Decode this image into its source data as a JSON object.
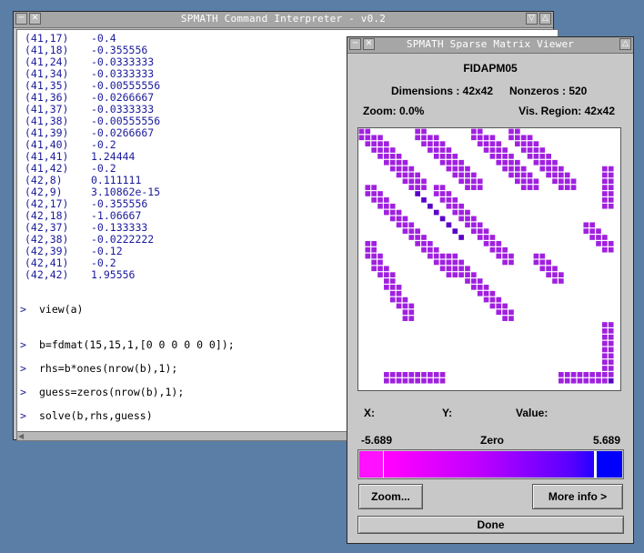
{
  "cmd_window": {
    "title": "SPMATH Command Interpreter - v0.2",
    "output_rows": [
      {
        "idx": "(41,17)",
        "val": "-0.4"
      },
      {
        "idx": "(41,18)",
        "val": "-0.355556"
      },
      {
        "idx": "(41,24)",
        "val": "-0.0333333"
      },
      {
        "idx": "(41,34)",
        "val": "-0.0333333"
      },
      {
        "idx": "(41,35)",
        "val": "-0.00555556"
      },
      {
        "idx": "(41,36)",
        "val": "-0.0266667"
      },
      {
        "idx": "(41,37)",
        "val": "-0.0333333"
      },
      {
        "idx": "(41,38)",
        "val": "-0.00555556"
      },
      {
        "idx": "(41,39)",
        "val": "-0.0266667"
      },
      {
        "idx": "(41,40)",
        "val": "-0.2"
      },
      {
        "idx": "(41,41)",
        "val": "1.24444"
      },
      {
        "idx": "(41,42)",
        "val": "-0.2"
      },
      {
        "idx": "(42,8)",
        "val": "0.111111"
      },
      {
        "idx": "(42,9)",
        "val": "3.10862e-15"
      },
      {
        "idx": "(42,17)",
        "val": "-0.355556"
      },
      {
        "idx": "(42,18)",
        "val": "-1.06667"
      },
      {
        "idx": "(42,37)",
        "val": "-0.133333"
      },
      {
        "idx": "(42,38)",
        "val": "-0.0222222"
      },
      {
        "idx": "(42,39)",
        "val": "-0.12"
      },
      {
        "idx": "(42,41)",
        "val": "-0.2"
      },
      {
        "idx": "(42,42)",
        "val": "1.95556"
      }
    ],
    "prompt_symbol": ">",
    "commands": [
      "view(a)",
      "b=fdmat(15,15,1,[0 0 0 0 0 0]);",
      "rhs=b*ones(nrow(b),1);",
      "guess=zeros(nrow(b),1);",
      "solve(b,rhs,guess)"
    ]
  },
  "viewer": {
    "title": "SPMATH Sparse Matrix Viewer",
    "matrix_name": "FIDAPM05",
    "dimensions_label": "Dimensions : 42x42",
    "nonzeros_label": "Nonzeros : 520",
    "zoom_label": "Zoom: 0.0%",
    "vis_region_label": "Vis. Region: 42x42",
    "x_label": "X:",
    "y_label": "Y:",
    "value_label": "Value:",
    "scale_min": "-5.689",
    "scale_mid": "Zero",
    "scale_max": "5.689",
    "zoom_button": "Zoom...",
    "more_info_button": "More info >",
    "done_button": "Done",
    "colors": {
      "negative": "#ff00ff",
      "positive": "#0000ff",
      "cell_main": "#a020e0",
      "cell_dark": "#5a00c8"
    }
  }
}
